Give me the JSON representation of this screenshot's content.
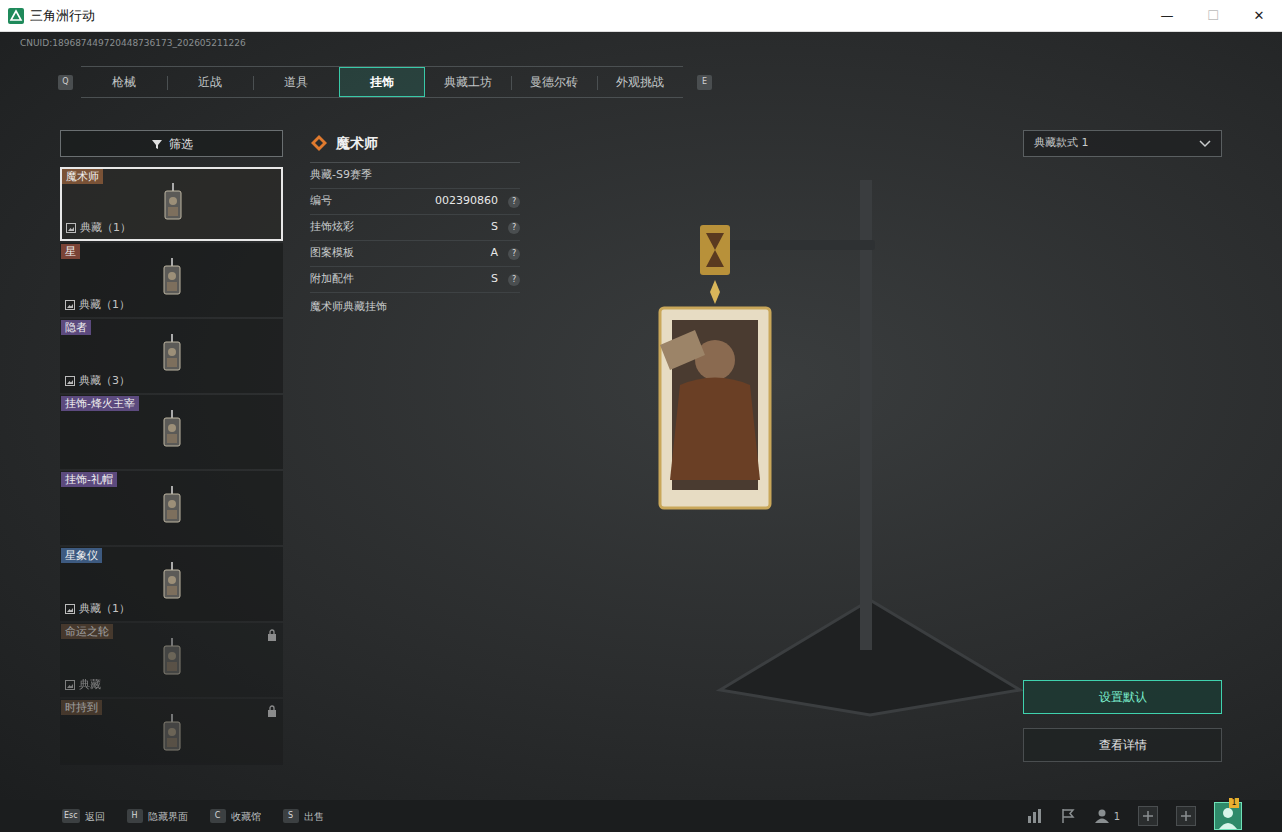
{
  "window": {
    "title": "三角洲行动",
    "controls": [
      "—",
      "☐",
      "✕"
    ]
  },
  "uid": "CNUID:189687449720448736173_202605211226",
  "tabs": {
    "prev_key": "Q",
    "next_key": "E",
    "items": [
      {
        "label": "枪械",
        "selected": false
      },
      {
        "label": "近战",
        "selected": false
      },
      {
        "label": "道具",
        "selected": false
      },
      {
        "label": "挂饰",
        "selected": true
      },
      {
        "label": "典藏工坊",
        "selected": false
      },
      {
        "label": "曼德尔砖",
        "selected": false
      },
      {
        "label": "外观挑战",
        "selected": false
      }
    ]
  },
  "filter": {
    "label": "筛选"
  },
  "items": [
    {
      "name": "魔术师",
      "color": "#7a5236",
      "collection": "典藏（1）",
      "selected": true,
      "locked": false
    },
    {
      "name": "星",
      "color": "#7a4336",
      "collection": "典藏（1）",
      "selected": false,
      "locked": false
    },
    {
      "name": "隐者",
      "color": "#5c4a7e",
      "collection": "典藏（3）",
      "selected": false,
      "locked": false
    },
    {
      "name": "挂饰-烽火主宰",
      "color": "#5c4a7e",
      "collection": "",
      "selected": false,
      "locked": false
    },
    {
      "name": "挂饰-礼帽",
      "color": "#5c4a7e",
      "collection": "",
      "selected": false,
      "locked": false
    },
    {
      "name": "星象仪",
      "color": "#3d5a80",
      "collection": "典藏（1）",
      "selected": false,
      "locked": false
    },
    {
      "name": "命运之轮",
      "color": "#5e4632",
      "collection": "典藏",
      "selected": false,
      "locked": true
    },
    {
      "name": "时持到",
      "color": "#5e4632",
      "collection": "",
      "selected": false,
      "locked": true
    }
  ],
  "detail": {
    "title": "魔术师",
    "season": "典藏-S9赛季",
    "rows": [
      {
        "label": "编号",
        "value": "002390860",
        "help": "?"
      },
      {
        "label": "挂饰炫彩",
        "value": "S",
        "help": "?"
      },
      {
        "label": "图案模板",
        "value": "A",
        "help": "?"
      },
      {
        "label": "附加配件",
        "value": "S",
        "help": "?"
      }
    ],
    "description": "魔术师典藏挂饰"
  },
  "style_select": {
    "value": "典藏款式 1"
  },
  "buttons": [
    {
      "label": "设置默认",
      "primary": true
    },
    {
      "label": "查看详情",
      "primary": false
    }
  ],
  "bottom_bar": {
    "keys": [
      {
        "key": "Esc",
        "label": "返回"
      },
      {
        "key": "H",
        "label": "隐藏界面"
      },
      {
        "key": "C",
        "label": "收藏馆"
      },
      {
        "key": "S",
        "label": "出售"
      }
    ],
    "party_count": "1",
    "badge": "1"
  }
}
